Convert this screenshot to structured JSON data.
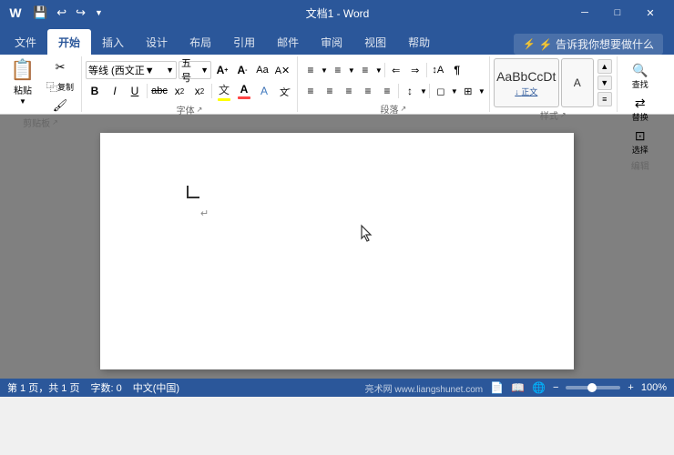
{
  "titlebar": {
    "title": "文档1 - Word",
    "quick_access": [
      "save",
      "undo",
      "redo",
      "customize"
    ],
    "window_controls": [
      "minimize",
      "restore",
      "close"
    ]
  },
  "ribbon": {
    "tabs": [
      "文件",
      "开始",
      "插入",
      "设计",
      "布局",
      "引用",
      "邮件",
      "审阅",
      "视图",
      "帮助"
    ],
    "active_tab": "开始",
    "help_placeholder": "⚡ 告诉我你想要做什么",
    "groups": {
      "clipboard": {
        "label": "剪贴板",
        "paste": "粘贴",
        "cut": "✂",
        "copy": "复制",
        "format_painter": "格式刷"
      },
      "font": {
        "label": "字体",
        "name": "等线 (西文正▼",
        "name_display": "等线 (西文正文)",
        "size": "五号",
        "size_num": "10.5",
        "bold": "B",
        "italic": "I",
        "underline": "U",
        "strikethrough": "abc",
        "subscript": "x₂",
        "superscript": "x²",
        "grow": "A",
        "shrink": "A",
        "clear": "A",
        "change_case": "Aa",
        "highlight": "文",
        "font_color": "A",
        "phonetic": "wén"
      },
      "paragraph": {
        "label": "段落",
        "bullets": "≡",
        "numbering": "≡",
        "multilevel": "≡",
        "decrease_indent": "⇐",
        "increase_indent": "⇒",
        "sort": "↕A",
        "show_marks": "¶",
        "align_left": "≡",
        "align_center": "≡",
        "align_right": "≡",
        "justify": "≡",
        "distribute": "≡",
        "line_spacing": "↕",
        "shading": "◻",
        "borders": "⊞"
      },
      "styles": {
        "label": "样式",
        "items": [
          "正文",
          "AaBbCcD"
        ],
        "active": "正文"
      },
      "editing": {
        "label": "编辑"
      }
    }
  },
  "document": {
    "page_indicator": "第1页，共1页",
    "word_count": "0个字",
    "language": "中文(中国)"
  },
  "statusbar": {
    "page_info": "第 1 页，共 1 页",
    "word_count": "字数: 0",
    "language": "中文(中国)",
    "watermark": "亮术网 www.liangshunet.com"
  }
}
